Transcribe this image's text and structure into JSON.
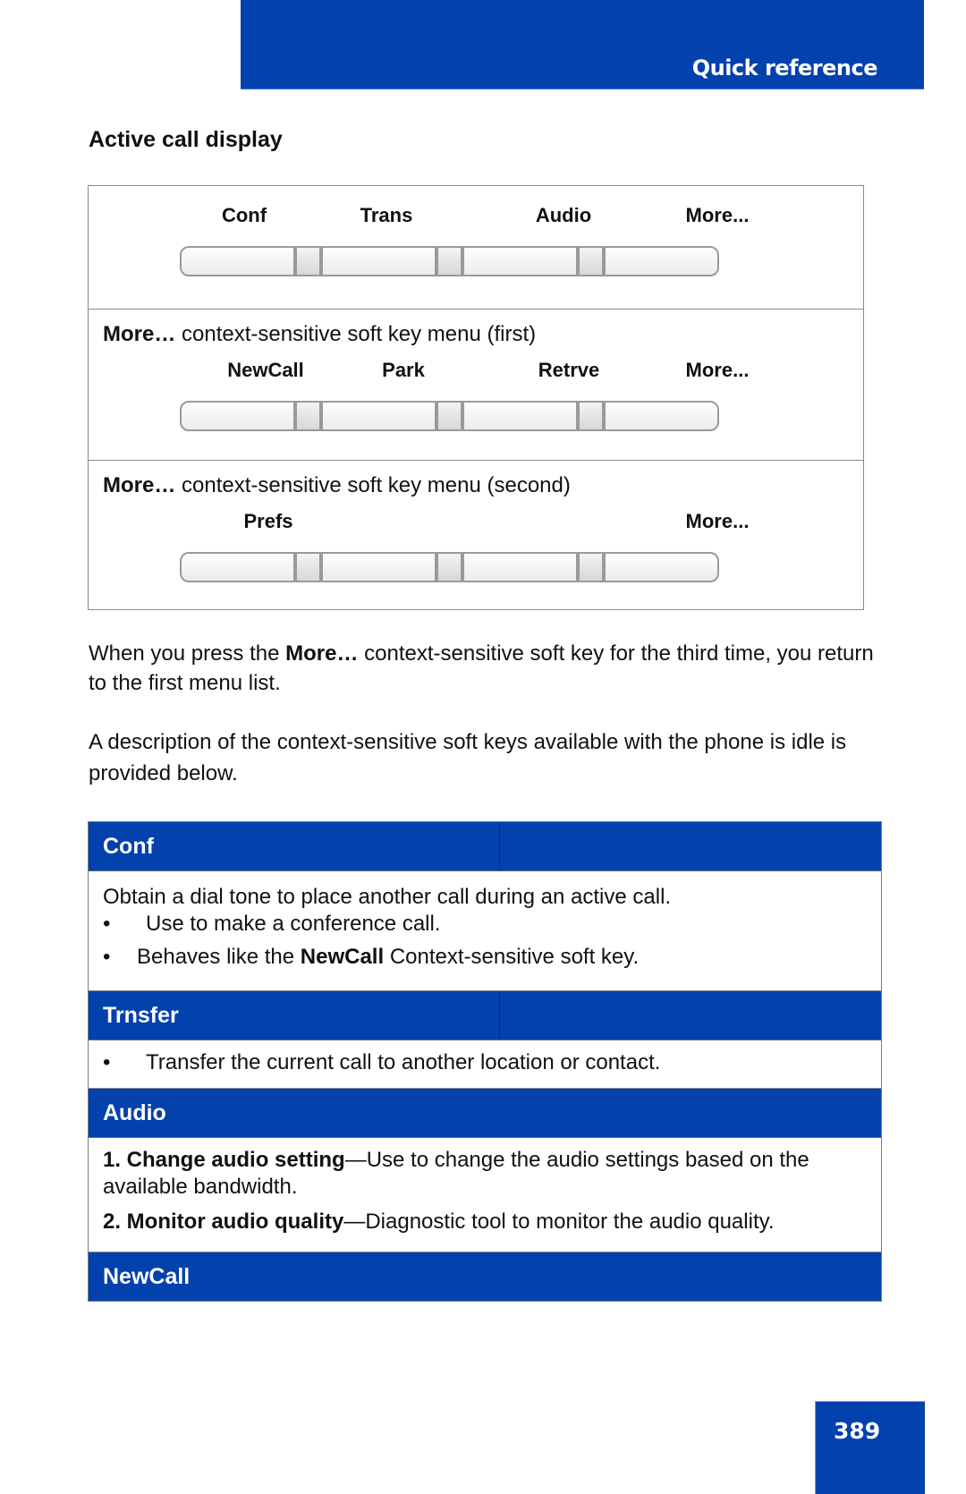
{
  "header": {
    "section_label": "Quick reference"
  },
  "page": {
    "number": "389"
  },
  "active_call": {
    "title": "Active call display",
    "panels": [
      {
        "caption_bold": "",
        "caption_text": "",
        "keys": [
          "Conf",
          "Trans",
          "Audio",
          "More..."
        ]
      },
      {
        "caption_bold": "More…",
        "caption_text": " context-sensitive soft key menu (first)",
        "keys": [
          "NewCall",
          "Park",
          "Retrve",
          "More..."
        ]
      },
      {
        "caption_bold": "More…",
        "caption_text": " context-sensitive soft key menu (second)",
        "keys": [
          "Prefs",
          "",
          "",
          "More..."
        ]
      }
    ]
  },
  "paragraphs": {
    "p1_before": "When you press the ",
    "p1_bold": "More…",
    "p1_after": " context-sensitive soft key for the third time, you return to the first menu list.",
    "p2": "A description of the context-sensitive soft keys available with the phone is idle is provided below."
  },
  "table": {
    "conf": {
      "header": "Conf",
      "line1": "Obtain a dial tone to place another call during an active call.",
      "bullet1": "Use to make a conference call.",
      "bullet2_before": "Behaves like the ",
      "bullet2_bold": "NewCall",
      "bullet2_after": " Context-sensitive soft key.",
      "bullet_char": "•"
    },
    "trnsfer": {
      "header": "Trnsfer",
      "bullet1": "Transfer the current call to another location or contact.",
      "bullet_char": "•"
    },
    "audio": {
      "header": "Audio",
      "item1_bold": "1. Change audio setting",
      "item1_text": "—Use to change the audio settings based on the available bandwidth.",
      "item2_bold": "2. Monitor audio quality",
      "item2_text": "—Diagnostic tool to monitor the audio quality."
    },
    "newcall": {
      "header": "NewCall"
    }
  }
}
